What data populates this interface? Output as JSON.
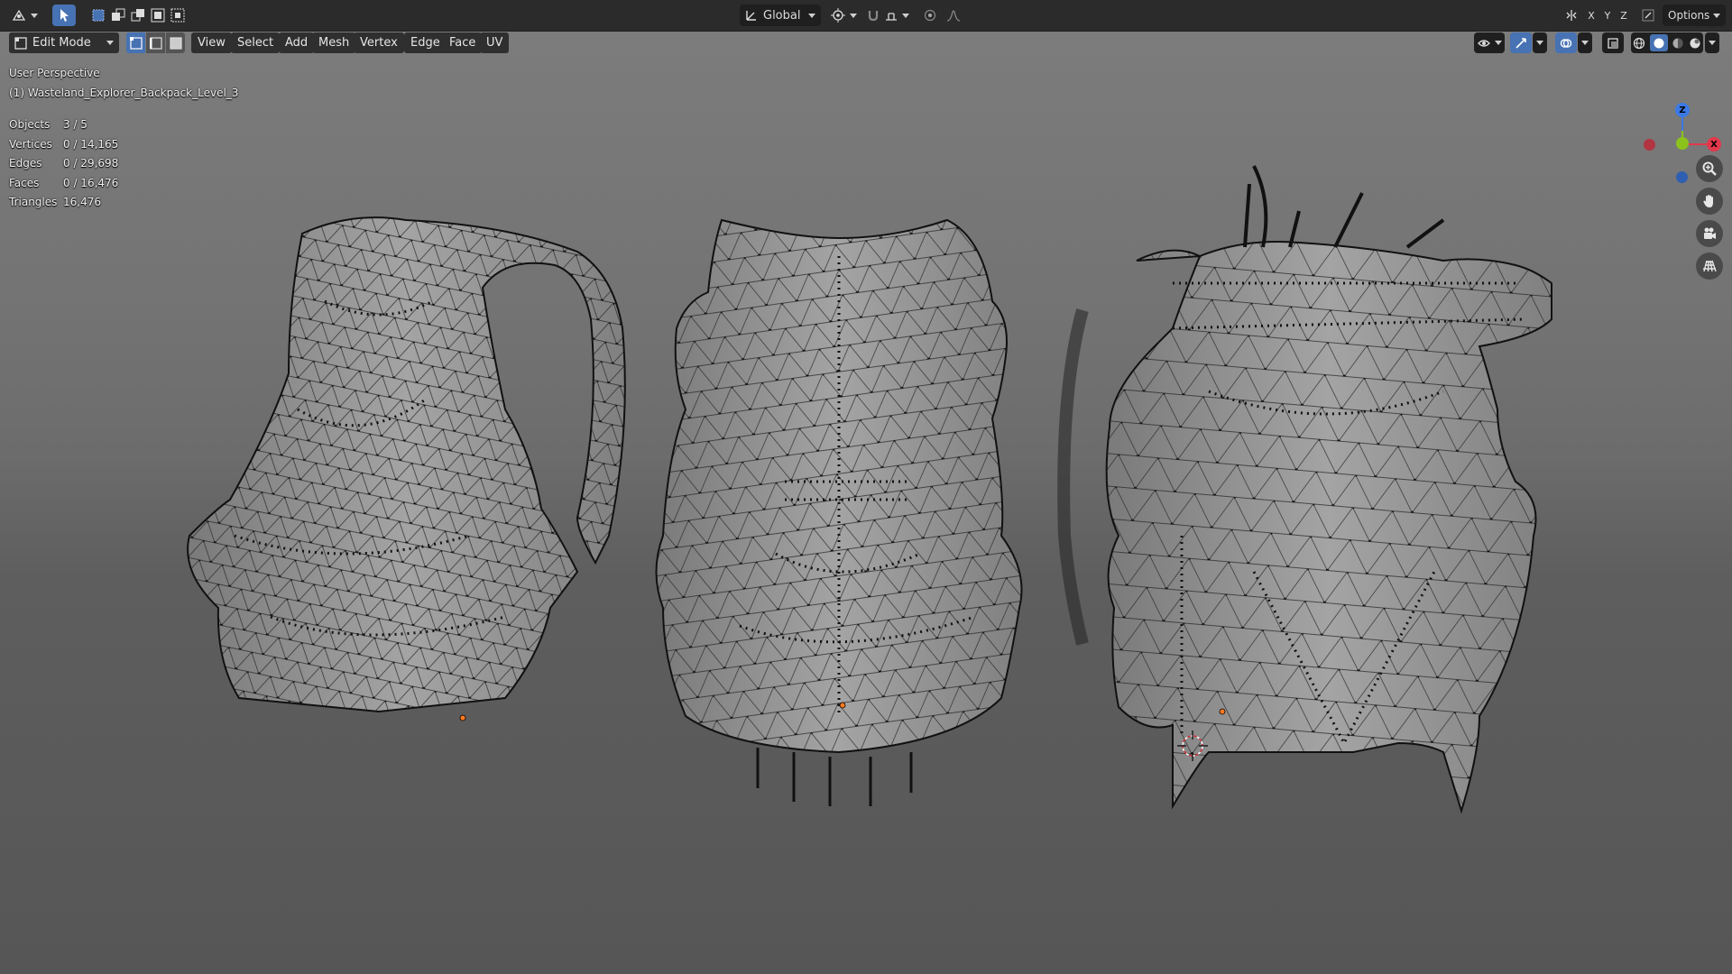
{
  "topbar": {
    "transform_orientation": "Global",
    "axes": [
      "X",
      "Y",
      "Z"
    ],
    "options_label": "Options"
  },
  "header": {
    "mode": "Edit Mode",
    "menus": [
      "View",
      "Select",
      "Add",
      "Mesh",
      "Vertex",
      "Edge",
      "Face",
      "UV"
    ]
  },
  "viewport": {
    "perspective_label": "User Perspective",
    "active_object": "(1) Wasteland_Explorer_Backpack_Level_3",
    "stats": [
      {
        "key": "Objects",
        "value": "3 / 5"
      },
      {
        "key": "Vertices",
        "value": "0 / 14,165"
      },
      {
        "key": "Edges",
        "value": "0 / 29,698"
      },
      {
        "key": "Faces",
        "value": "0 / 16,476"
      },
      {
        "key": "Triangles",
        "value": "16,476"
      }
    ],
    "gizmo": {
      "z": "Z",
      "x": "X"
    }
  },
  "icons": [
    "editor-type-icon",
    "select-tool-icon",
    "select-mode-icons",
    "orientation-icon",
    "pivot-icon",
    "snap-icon",
    "proportional-icon",
    "gizmo-toggle-icon",
    "overlay-icon",
    "xray-icon",
    "wireframe-shading-icon",
    "solid-shading-icon",
    "material-shading-icon",
    "rendered-shading-icon",
    "zoom-icon",
    "hand-icon",
    "camera-icon",
    "grid-icon"
  ],
  "colors": {
    "accent": "#4772b3",
    "axis_x": "#e3384b",
    "axis_y": "#8bc21c",
    "axis_z": "#3b79e6"
  }
}
